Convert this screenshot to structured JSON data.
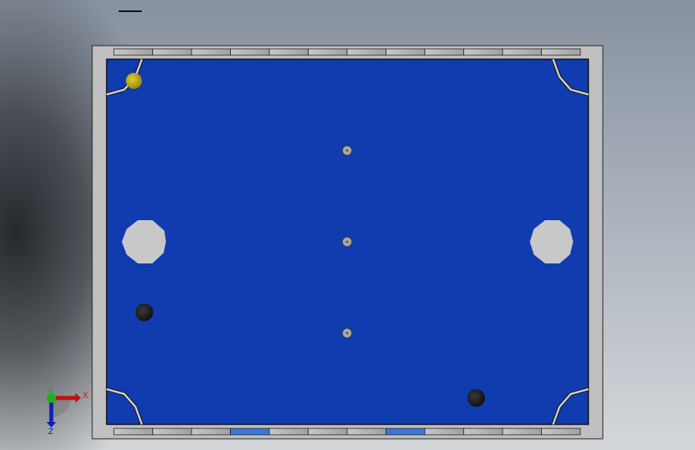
{
  "viewport": {
    "background_top": "#87929f",
    "background_bottom": "#d4d7da"
  },
  "model": {
    "frame_color": "#c0c0c0",
    "felt_color": "#103cb0",
    "pocket_color": "#c8c8c8",
    "yellow_ball_color": "#c8b81e",
    "black_ball_color": "#202020"
  },
  "triad": {
    "x_label": "X",
    "y_label": "Y",
    "z_label": "Z",
    "x_color": "#d01010",
    "y_color": "#10b010",
    "z_color": "#1020c0"
  }
}
